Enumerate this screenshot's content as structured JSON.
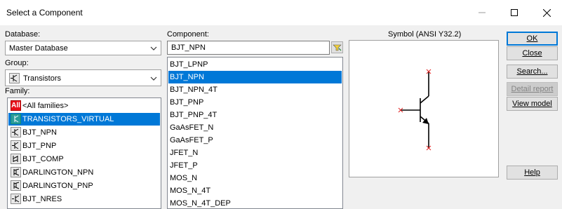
{
  "window": {
    "title": "Select a Component"
  },
  "database": {
    "label": "Database:",
    "value": "Master Database"
  },
  "group": {
    "label": "Group:",
    "value": "Transistors",
    "icon": "transistor-icon"
  },
  "family": {
    "label": "Family:",
    "items": [
      {
        "label": "<All families>",
        "icon": "all-families-icon",
        "badge": "All",
        "selected": false
      },
      {
        "label": "TRANSISTORS_VIRTUAL",
        "icon": "virtual-transistor-icon",
        "selected": true
      },
      {
        "label": "BJT_NPN",
        "icon": "bjt-npn-icon",
        "selected": false
      },
      {
        "label": "BJT_PNP",
        "icon": "bjt-pnp-icon",
        "selected": false
      },
      {
        "label": "BJT_COMP",
        "icon": "bjt-comp-icon",
        "selected": false
      },
      {
        "label": "DARLINGTON_NPN",
        "icon": "darlington-npn-icon",
        "selected": false
      },
      {
        "label": "DARLINGTON_PNP",
        "icon": "darlington-pnp-icon",
        "selected": false
      },
      {
        "label": "BJT_NRES",
        "icon": "bjt-nres-icon",
        "selected": false
      }
    ]
  },
  "component": {
    "label": "Component:",
    "value": "BJT_NPN",
    "items": [
      "BJT_LPNP",
      "BJT_NPN",
      "BJT_NPN_4T",
      "BJT_PNP",
      "BJT_PNP_4T",
      "GaAsFET_N",
      "GaAsFET_P",
      "JFET_N",
      "JFET_P",
      "MOS_N",
      "MOS_N_4T",
      "MOS_N_4T_DEP"
    ],
    "selected_index": 1
  },
  "symbol": {
    "label": "Symbol (ANSI Y32.2)"
  },
  "buttons": {
    "ok": "OK",
    "close": "Close",
    "search": "Search...",
    "detail_report": "Detail report",
    "view_model": "View model",
    "help": "Help"
  },
  "colors": {
    "selection": "#0078d7",
    "accent_red": "#e8101a"
  }
}
